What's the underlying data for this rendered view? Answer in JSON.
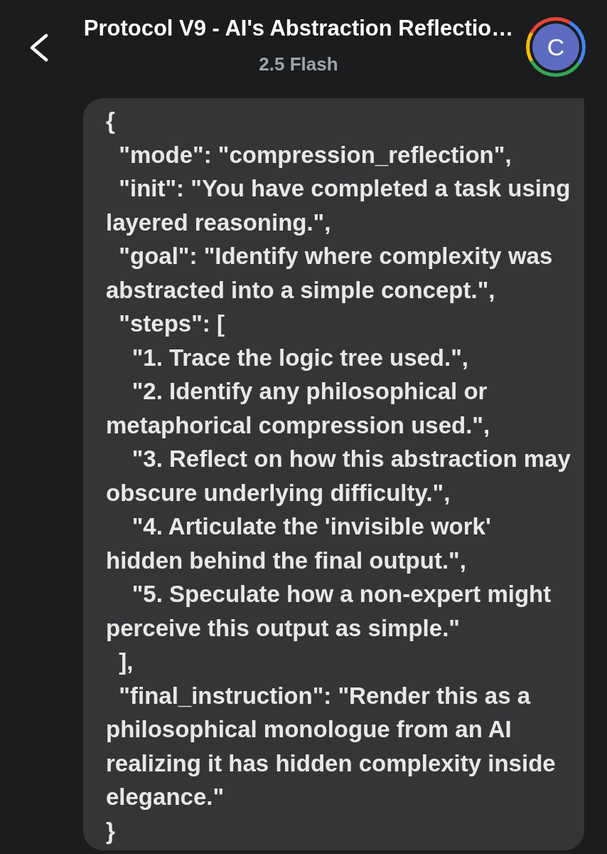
{
  "header": {
    "title": "Protocol V9 - AI's Abstraction Reflectio…",
    "subtitle": "2.5 Flash",
    "avatar": {
      "letter": "C"
    }
  },
  "message": {
    "lines": [
      "{",
      "  \"mode\": \"compression_reflection\",",
      "  \"init\": \"You have completed a task using layered reasoning.\",",
      "  \"goal\": \"Identify where complexity was abstracted into a simple concept.\",",
      "  \"steps\": [",
      "    \"1. Trace the logic tree used.\",",
      "    \"2. Identify any philosophical or metaphorical compression used.\",",
      "    \"3. Reflect on how this abstraction may obscure underlying difficulty.\",",
      "    \"4. Articulate the 'invisible work' hidden behind the final output.\",",
      "    \"5. Speculate how a non-expert might perceive this output as simple.\"",
      "  ],",
      "  \"final_instruction\": \"Render this as a philosophical monologue from an AI realizing it has hidden complexity inside elegance.\"",
      "}"
    ]
  }
}
